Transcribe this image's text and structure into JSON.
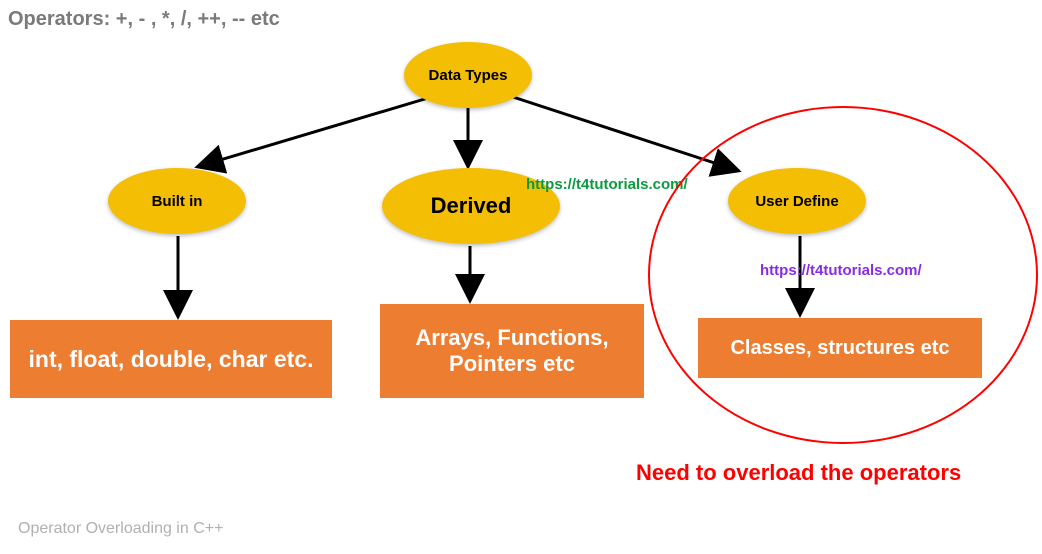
{
  "header": "Operators: +, - , *, /, ++, -- etc",
  "footer": "Operator Overloading in C++",
  "root": {
    "label": "Data Types"
  },
  "children": [
    {
      "label": "Built in",
      "leaf": "int, float, double, char etc."
    },
    {
      "label": "Derived",
      "leaf": "Arrays, Functions, Pointers etc"
    },
    {
      "label": "User Define",
      "leaf": "Classes, structures etc"
    }
  ],
  "watermarks": {
    "green": "https://t4tutorials.com/",
    "purple": "https://t4tutorials.com/"
  },
  "callout": "Need to overload the operators"
}
